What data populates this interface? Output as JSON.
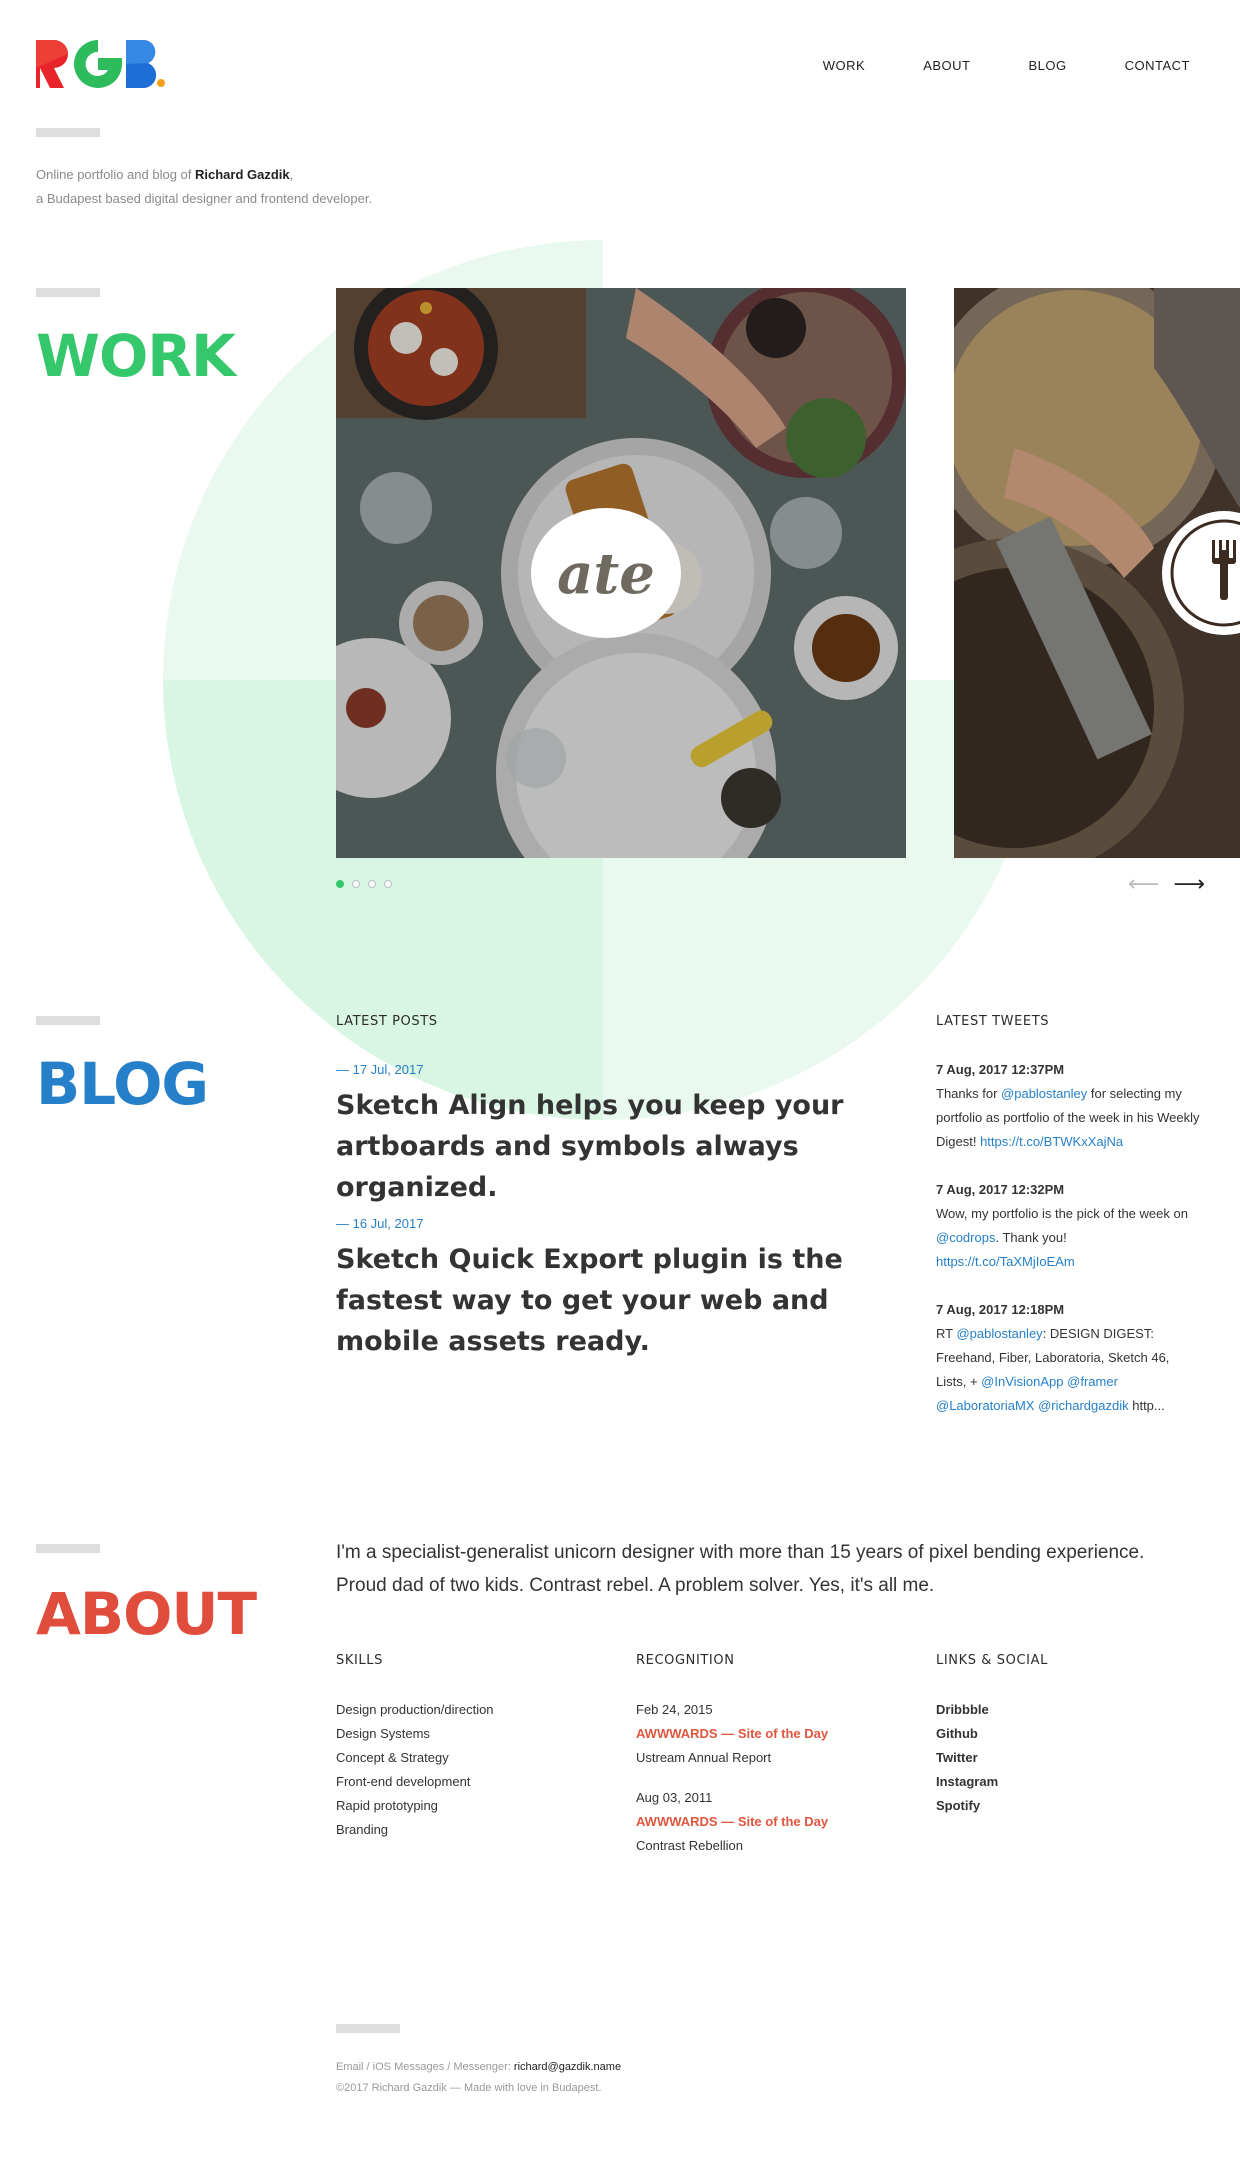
{
  "nav": {
    "items": [
      "WORK",
      "ABOUT",
      "BLOG",
      "CONTACT"
    ]
  },
  "intro": {
    "prefix": "Online portfolio and blog of ",
    "name": "Richard Gazdik",
    "suffix": ",",
    "line2": "a Budapest based digital designer and frontend developer."
  },
  "work": {
    "title": "WORK",
    "slide1_logo_text": "ate",
    "carousel_total": 4,
    "carousel_active": 1
  },
  "blog": {
    "title": "BLOG",
    "posts_heading": "LATEST POSTS",
    "posts": [
      {
        "date": "— 17 Jul, 2017",
        "title": "Sketch Align helps you keep your artboards and symbols always organized."
      },
      {
        "date": "— 16 Jul, 2017",
        "title": "Sketch Quick Export plugin is the fastest way to get your web and mobile assets ready."
      }
    ],
    "tweets_heading": "LATEST TWEETS",
    "tweets": [
      {
        "time": "7 Aug, 2017 12:37PM"
      },
      {
        "time": "7 Aug, 2017 12:32PM"
      },
      {
        "time": "7 Aug, 2017 12:18PM"
      }
    ],
    "tweet1": {
      "t1": "Thanks for ",
      "l1": "@pablostanley",
      "t2": " for selecting my portfolio as portfolio of the week in his Weekly Digest! ",
      "l2": "https://t.co/BTWKxXajNa"
    },
    "tweet2": {
      "t1": "Wow, my portfolio is the pick of the week on ",
      "l1": "@codrops",
      "t2": ". Thank you! ",
      "l2": "https://t.co/TaXMjIoEAm"
    },
    "tweet3": {
      "t1": "RT ",
      "l1": "@pablostanley",
      "t2": ": DESIGN DIGEST: Freehand, Fiber, Laboratoria, Sketch 46, Lists, + ",
      "l2": "@InVisionApp",
      "l3": "@framer",
      "l4": "@LaboratoriaMX",
      "l5": "@richardgazdik",
      "t3": " http..."
    }
  },
  "about": {
    "title": "ABOUT",
    "text": "I'm a specialist-generalist unicorn designer with more than 15 years of pixel bending experience. Proud dad of two kids. Contrast rebel. A problem solver. Yes, it's all me.",
    "skills_heading": "SKILLS",
    "skills": [
      "Design production/direction",
      "Design Systems",
      "Concept & Strategy",
      "Front-end development",
      "Rapid prototyping",
      "Branding"
    ],
    "recognition_heading": "RECOGNITION",
    "recognition": [
      {
        "date": "Feb 24, 2015",
        "award": "AWWWARDS — Site of the Day",
        "project": "Ustream Annual Report"
      },
      {
        "date": "Aug 03, 2011",
        "award": "AWWWARDS — Site of the Day",
        "project": "Contrast Rebellion"
      }
    ],
    "links_heading": "LINKS & SOCIAL",
    "links": [
      "Dribbble",
      "Github",
      "Twitter",
      "Instagram",
      "Spotify"
    ]
  },
  "footer": {
    "contact_label": "Email / iOS Messages / Messenger: ",
    "email": "richard@gazdik.name",
    "copyright": "©2017 Richard Gazdik — Made with love in Budapest."
  },
  "colors": {
    "work_green": "#35c76b",
    "blog_blue": "#2680c9",
    "about_red": "#e14d3c",
    "award_orange": "#e0573e"
  },
  "icons": [
    "rgb-logo",
    "fork-icon",
    "arrow-left-icon",
    "arrow-right-icon"
  ]
}
